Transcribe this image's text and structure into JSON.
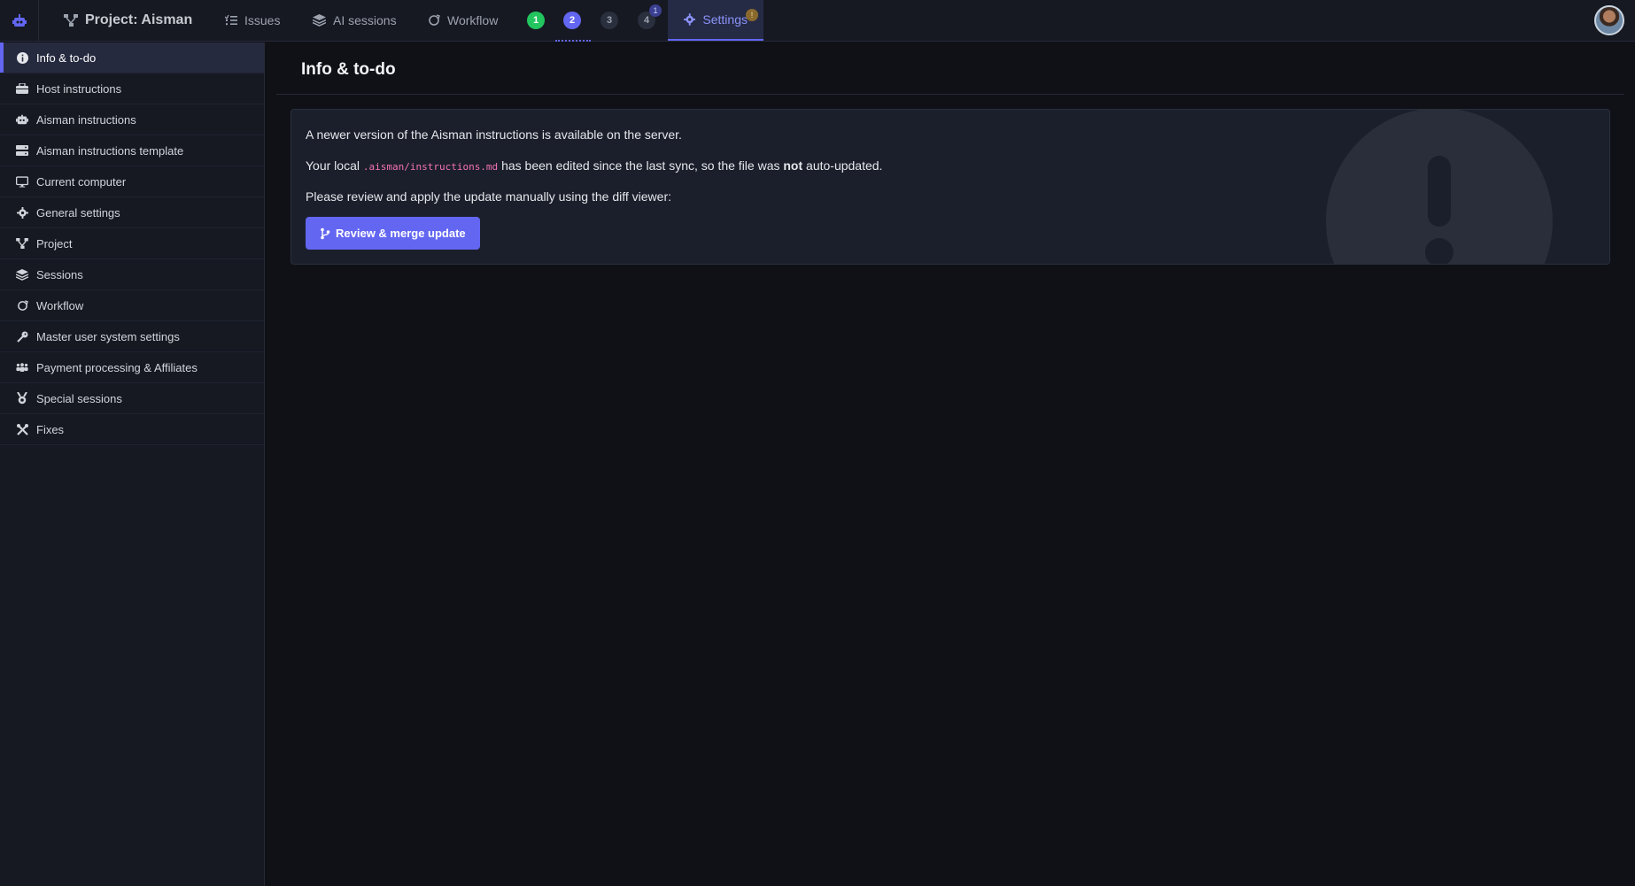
{
  "topbar": {
    "project_title": "Project: Aisman",
    "nav": {
      "issues": "Issues",
      "ai_sessions": "AI sessions",
      "workflow": "Workflow",
      "settings": "Settings"
    },
    "sessions": [
      {
        "label": "1",
        "color": "#22c55e"
      },
      {
        "label": "2",
        "color": "#6366f1"
      },
      {
        "label": "3",
        "color": "#2a2f3e"
      },
      {
        "label": "4",
        "color": "#2a2f3e",
        "badge": "1"
      }
    ],
    "settings_badge": "!"
  },
  "sidebar": {
    "items": [
      {
        "label": "Info & to-do",
        "icon": "info-icon"
      },
      {
        "label": "Host instructions",
        "icon": "host-icon"
      },
      {
        "label": "Aisman instructions",
        "icon": "robot-icon"
      },
      {
        "label": "Aisman instructions template",
        "icon": "server-icon"
      },
      {
        "label": "Current computer",
        "icon": "monitor-icon"
      },
      {
        "label": "General settings",
        "icon": "gear-icon"
      },
      {
        "label": "Project",
        "icon": "project-icon"
      },
      {
        "label": "Sessions",
        "icon": "layers-icon"
      },
      {
        "label": "Workflow",
        "icon": "workflow-icon"
      },
      {
        "label": "Master user system settings",
        "icon": "key-icon"
      },
      {
        "label": "Payment processing & Affiliates",
        "icon": "people-icon"
      },
      {
        "label": "Special sessions",
        "icon": "medal-icon"
      },
      {
        "label": "Fixes",
        "icon": "tools-icon"
      }
    ]
  },
  "main": {
    "title": "Info & to-do",
    "notice": {
      "line1": "A newer version of the Aisman instructions is available on the server.",
      "line2_pre": "Your local ",
      "line2_code": ".aisman/instructions.md",
      "line2_mid": " has been edited since the last sync, so the file was ",
      "line2_bold": "not",
      "line2_post": " auto-updated.",
      "line3": "Please review and apply the update manually using the diff viewer:",
      "button": "Review & merge update"
    }
  },
  "colors": {
    "accent": "#6366f1",
    "success": "#22c55e",
    "code": "#f472b6"
  }
}
